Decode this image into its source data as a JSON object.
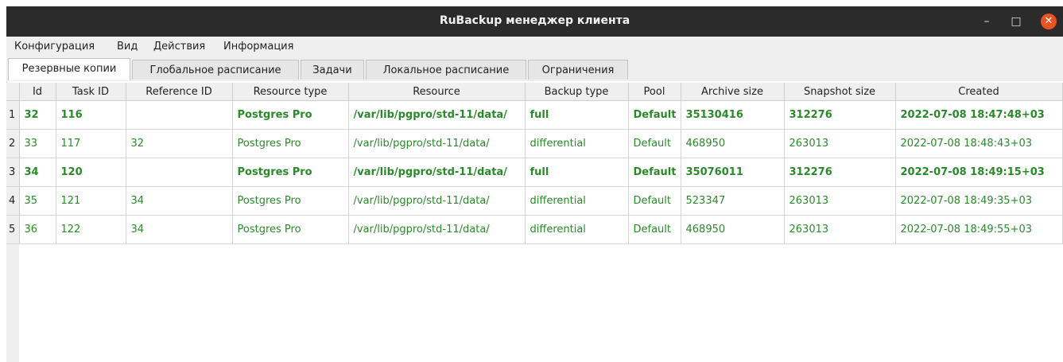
{
  "window": {
    "title": "RuBackup менеджер клиента",
    "minimize_glyph": "–",
    "maximize_glyph": "□",
    "close_glyph": "✕"
  },
  "menu": [
    "Конфигурация",
    "Вид",
    "Действия",
    "Информация"
  ],
  "tabs": [
    "Резервные копии",
    "Глобальное расписание",
    "Задачи",
    "Локальное расписание",
    "Ограничения"
  ],
  "active_tab": 0,
  "table": {
    "columns": [
      "Id",
      "Task ID",
      "Reference ID",
      "Resource type",
      "Resource",
      "Backup type",
      "Pool",
      "Archive size",
      "Snapshot size",
      "Created"
    ],
    "rows": [
      {
        "num": "1",
        "bold": true,
        "cells": [
          "32",
          "116",
          "",
          "Postgres Pro",
          "/var/lib/pgpro/std-11/data/",
          "full",
          "Default",
          "35130416",
          "312276",
          "2022-07-08 18:47:48+03"
        ]
      },
      {
        "num": "2",
        "bold": false,
        "cells": [
          "33",
          "117",
          "32",
          "Postgres Pro",
          "/var/lib/pgpro/std-11/data/",
          "differential",
          "Default",
          "468950",
          "263013",
          "2022-07-08 18:48:43+03"
        ]
      },
      {
        "num": "3",
        "bold": true,
        "cells": [
          "34",
          "120",
          "",
          "Postgres Pro",
          "/var/lib/pgpro/std-11/data/",
          "full",
          "Default",
          "35076011",
          "312276",
          "2022-07-08 18:49:15+03"
        ]
      },
      {
        "num": "4",
        "bold": false,
        "cells": [
          "35",
          "121",
          "34",
          "Postgres Pro",
          "/var/lib/pgpro/std-11/data/",
          "differential",
          "Default",
          "523347",
          "263013",
          "2022-07-08 18:49:35+03"
        ]
      },
      {
        "num": "5",
        "bold": false,
        "cells": [
          "36",
          "122",
          "34",
          "Postgres Pro",
          "/var/lib/pgpro/std-11/data/",
          "differential",
          "Default",
          "468950",
          "263013",
          "2022-07-08 18:49:55+03"
        ]
      }
    ]
  },
  "colors": {
    "title_bg": "#2b2b2b",
    "close_button": "#e95420",
    "row_text": "#2a8a2a",
    "chrome_bg": "#efefef"
  }
}
